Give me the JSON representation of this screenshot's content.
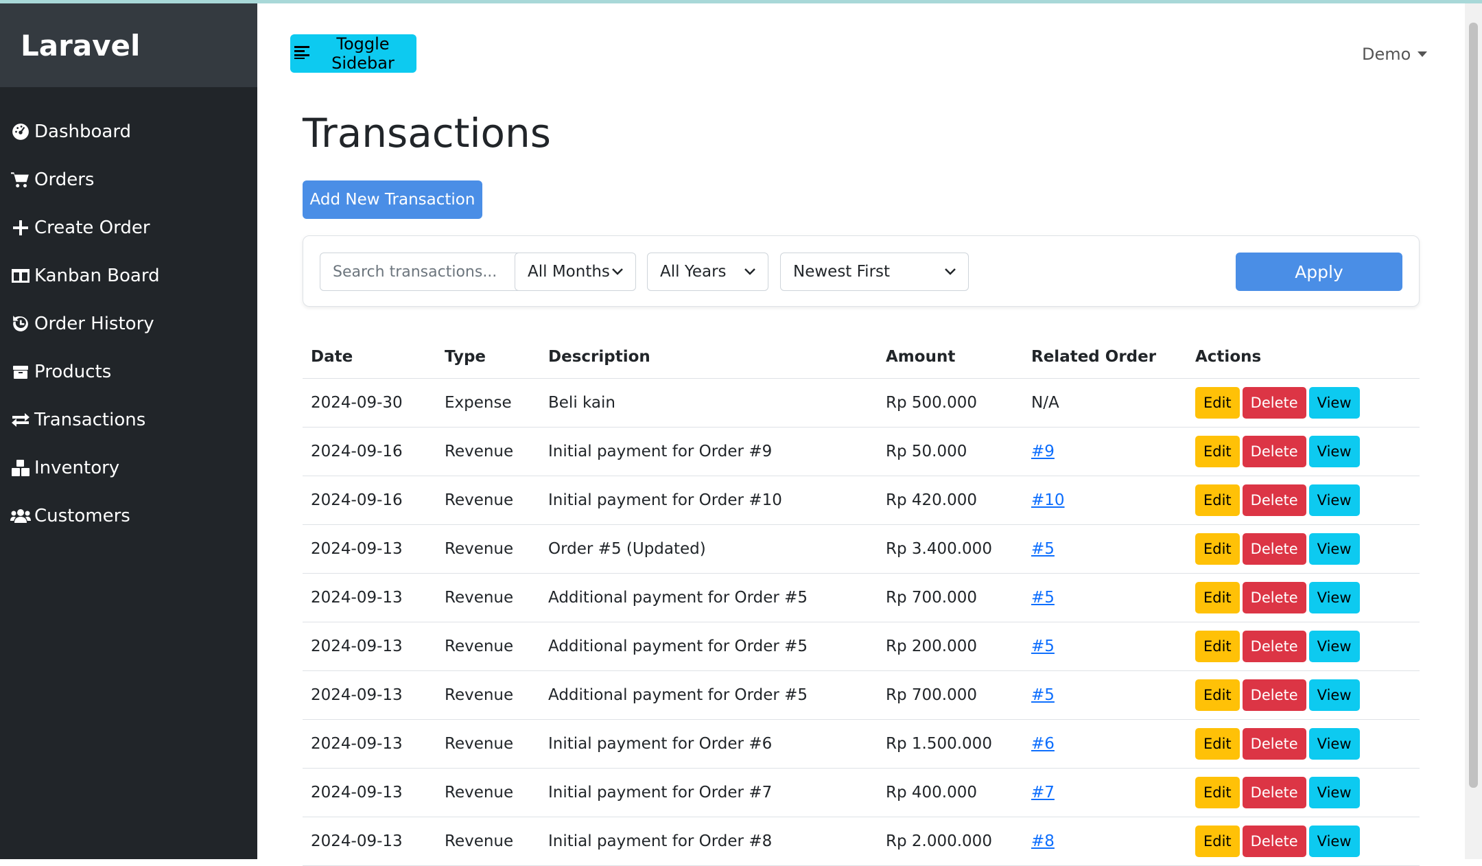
{
  "app": {
    "brand": "Laravel"
  },
  "sidebar": {
    "items": [
      {
        "label": "Dashboard",
        "icon": "gauge-icon"
      },
      {
        "label": "Orders",
        "icon": "cart-icon"
      },
      {
        "label": "Create Order",
        "icon": "plus-icon"
      },
      {
        "label": "Kanban Board",
        "icon": "columns-icon"
      },
      {
        "label": "Order History",
        "icon": "history-icon"
      },
      {
        "label": "Products",
        "icon": "box-icon"
      },
      {
        "label": "Transactions",
        "icon": "exchange-icon"
      },
      {
        "label": "Inventory",
        "icon": "boxes-icon"
      },
      {
        "label": "Customers",
        "icon": "users-icon"
      }
    ]
  },
  "header": {
    "toggle_label": "Toggle Sidebar",
    "user_name": "Demo"
  },
  "page": {
    "title": "Transactions",
    "add_label": "Add New Transaction"
  },
  "filters": {
    "search_placeholder": "Search transactions...",
    "month": "All Months",
    "year": "All Years",
    "sort": "Newest First",
    "apply_label": "Apply"
  },
  "table": {
    "headers": [
      "Date",
      "Type",
      "Description",
      "Amount",
      "Related Order",
      "Actions"
    ],
    "action_labels": {
      "edit": "Edit",
      "delete": "Delete",
      "view": "View"
    },
    "rows": [
      {
        "date": "2024-09-30",
        "type": "Expense",
        "description": "Beli kain",
        "amount": "Rp 500.000",
        "order": "N/A",
        "order_link": false
      },
      {
        "date": "2024-09-16",
        "type": "Revenue",
        "description": "Initial payment for Order #9",
        "amount": "Rp 50.000",
        "order": "#9",
        "order_link": true
      },
      {
        "date": "2024-09-16",
        "type": "Revenue",
        "description": "Initial payment for Order #10",
        "amount": "Rp 420.000",
        "order": "#10",
        "order_link": true
      },
      {
        "date": "2024-09-13",
        "type": "Revenue",
        "description": "Order #5 (Updated)",
        "amount": "Rp 3.400.000",
        "order": "#5",
        "order_link": true
      },
      {
        "date": "2024-09-13",
        "type": "Revenue",
        "description": "Additional payment for Order #5",
        "amount": "Rp 700.000",
        "order": "#5",
        "order_link": true
      },
      {
        "date": "2024-09-13",
        "type": "Revenue",
        "description": "Additional payment for Order #5",
        "amount": "Rp 200.000",
        "order": "#5",
        "order_link": true
      },
      {
        "date": "2024-09-13",
        "type": "Revenue",
        "description": "Additional payment for Order #5",
        "amount": "Rp 700.000",
        "order": "#5",
        "order_link": true
      },
      {
        "date": "2024-09-13",
        "type": "Revenue",
        "description": "Initial payment for Order #6",
        "amount": "Rp 1.500.000",
        "order": "#6",
        "order_link": true
      },
      {
        "date": "2024-09-13",
        "type": "Revenue",
        "description": "Initial payment for Order #7",
        "amount": "Rp 400.000",
        "order": "#7",
        "order_link": true
      },
      {
        "date": "2024-09-13",
        "type": "Revenue",
        "description": "Initial payment for Order #8",
        "amount": "Rp 2.000.000",
        "order": "#8",
        "order_link": true
      }
    ]
  },
  "colors": {
    "sidebar_bg": "#212529",
    "brand_bg": "#343a40",
    "primary": "#4a8ee6",
    "info": "#0dcaf0",
    "warning": "#ffc107",
    "danger": "#dc3545",
    "link": "#0d6efd"
  }
}
